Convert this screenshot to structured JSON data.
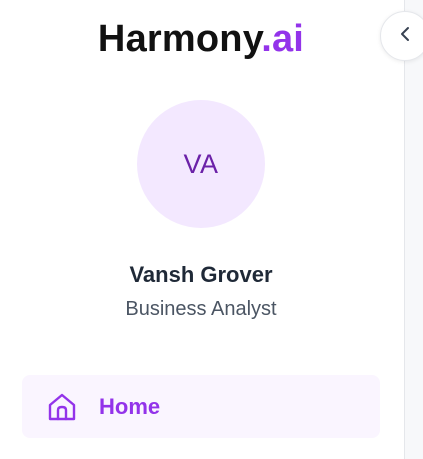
{
  "brand": {
    "name": "Harmony",
    "suffix": ".ai",
    "accent_color": "#9333ea"
  },
  "user": {
    "initials": "VA",
    "name": "Vansh Grover",
    "role": "Business Analyst"
  },
  "nav": {
    "items": [
      {
        "label": "Home",
        "icon": "home-icon",
        "active": true
      }
    ]
  },
  "collapse_button": {
    "icon": "chevron-left-icon"
  }
}
